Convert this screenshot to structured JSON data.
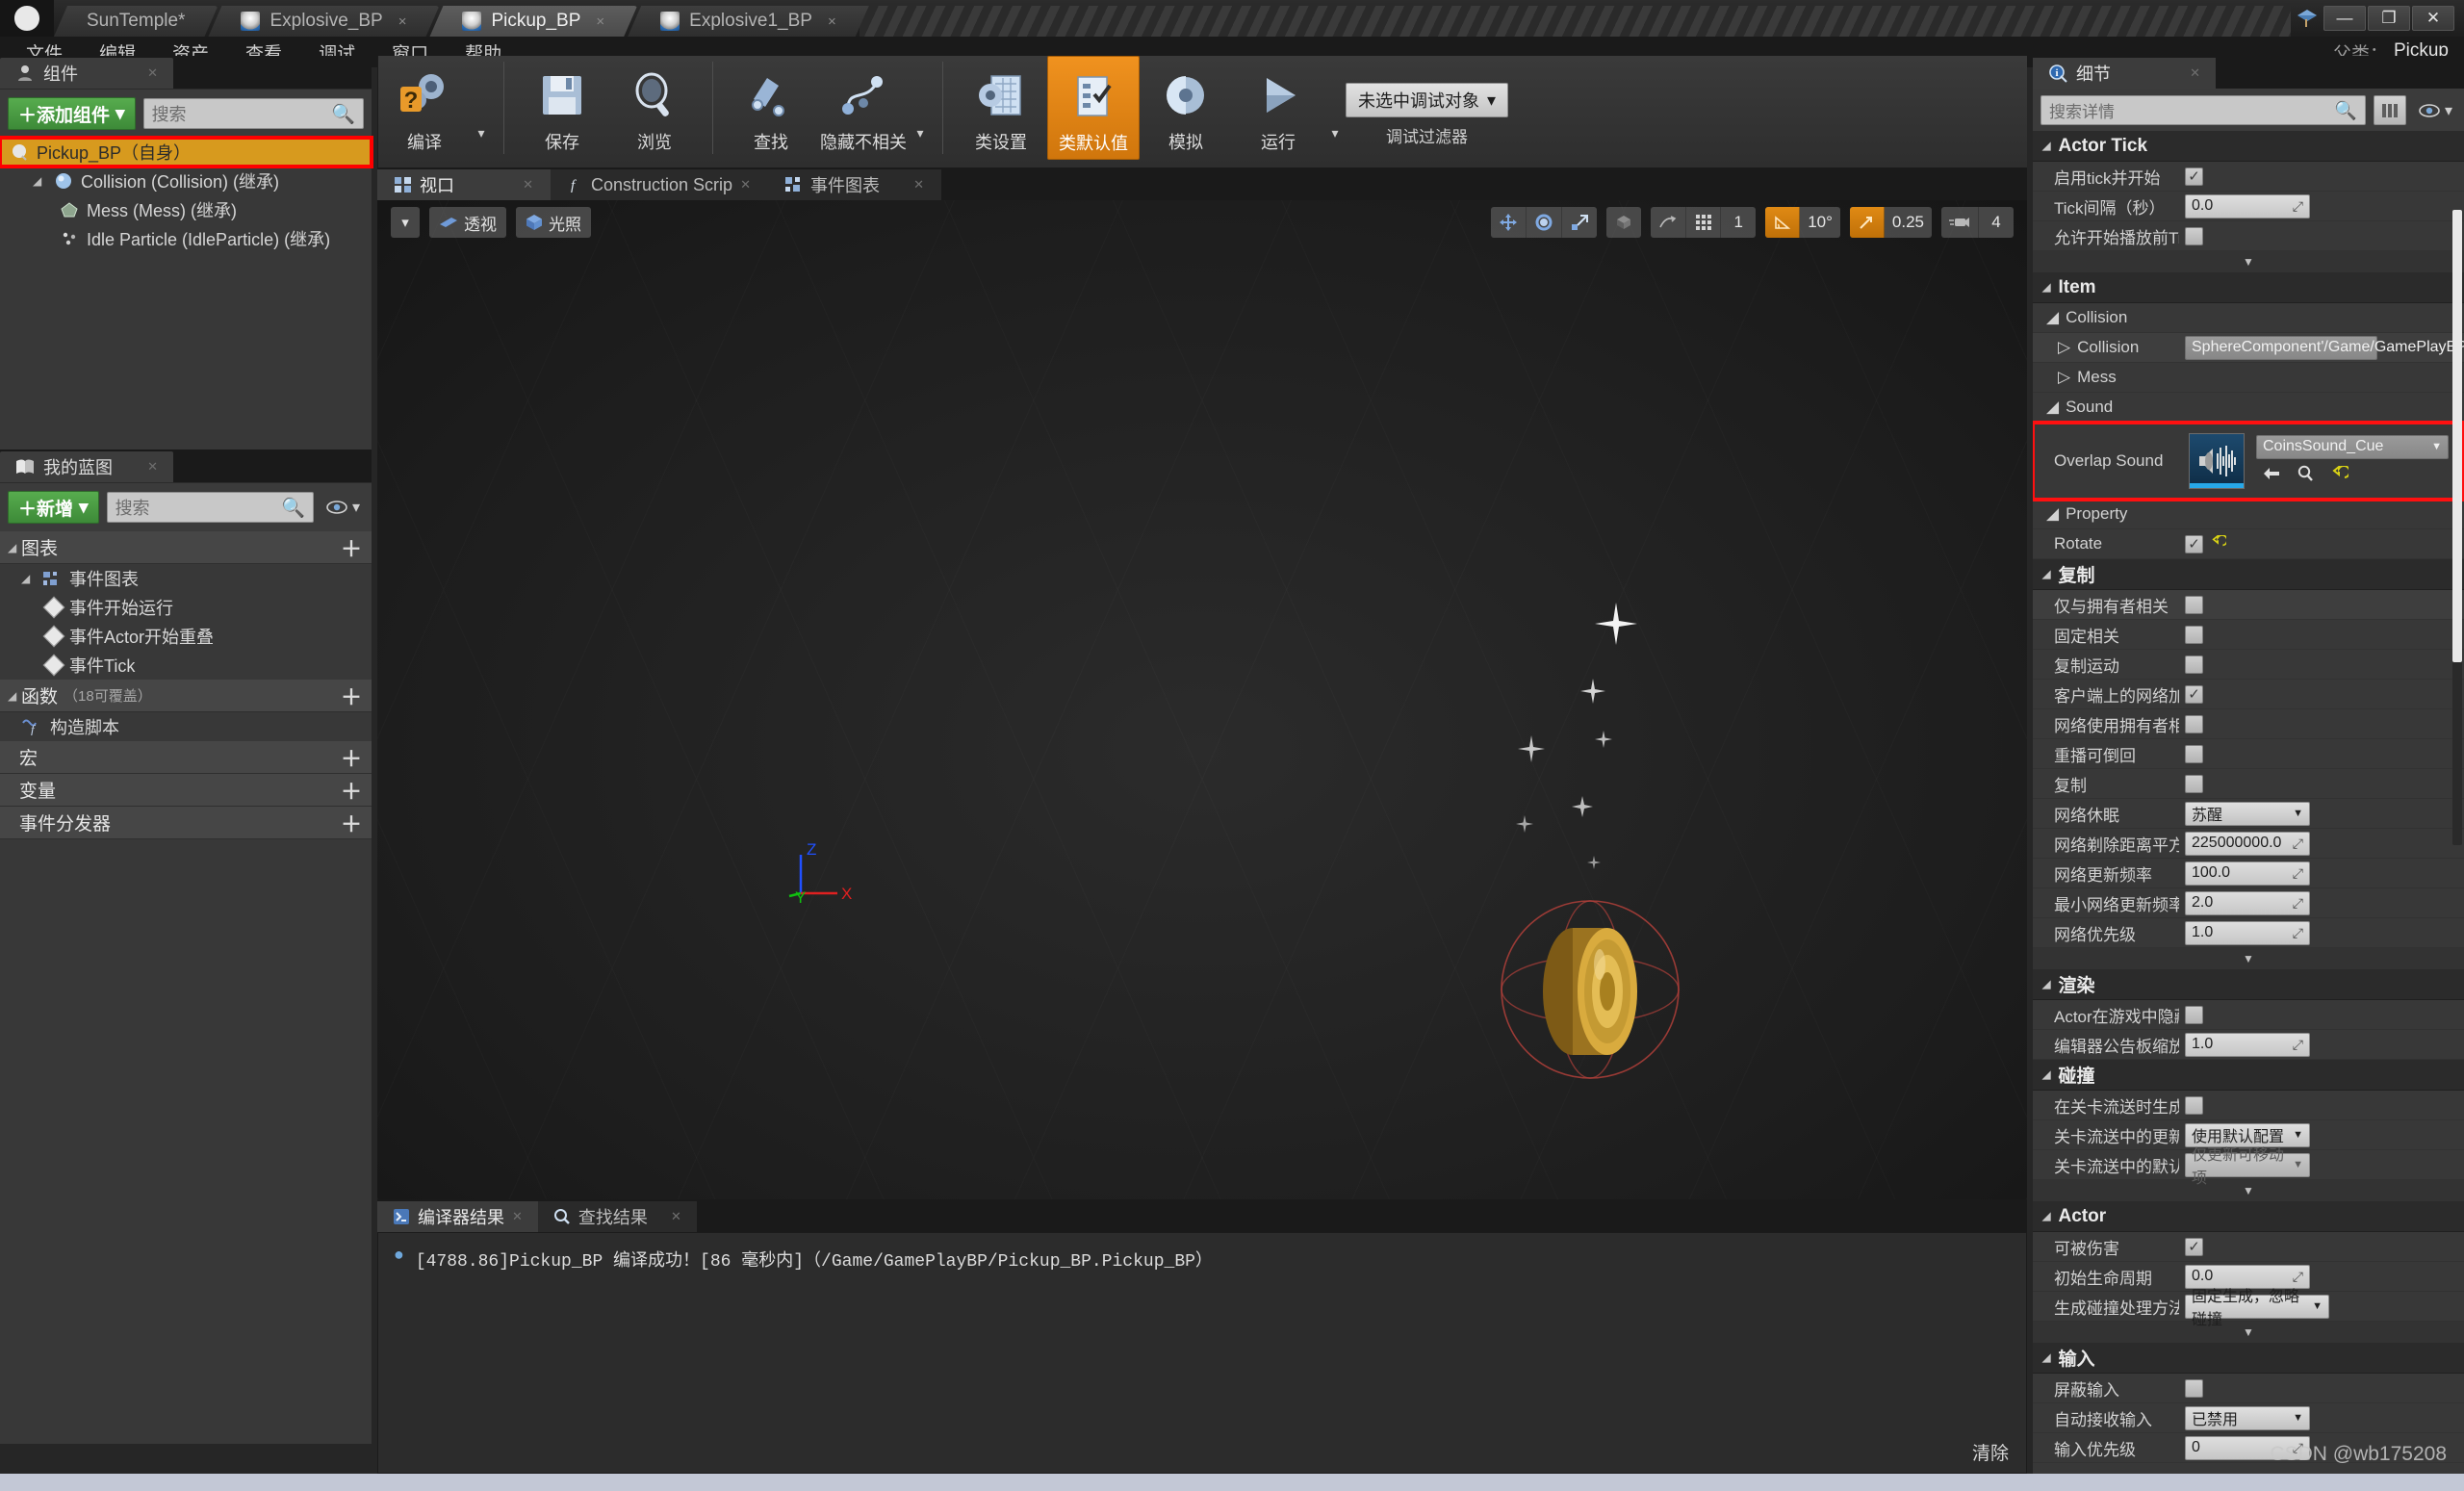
{
  "titlebar": {
    "logo": "U",
    "tabs": [
      {
        "label": "SunTemple*",
        "kind": "level",
        "state": "dim"
      },
      {
        "label": "Explosive_BP",
        "kind": "bp",
        "state": "dim"
      },
      {
        "label": "Pickup_BP",
        "kind": "bp",
        "state": "active"
      },
      {
        "label": "Explosive1_BP",
        "kind": "bp",
        "state": "dim"
      }
    ],
    "close_glyph": "×",
    "window_buttons": [
      {
        "name": "minimize",
        "glyph": "—"
      },
      {
        "name": "maximize",
        "glyph": "❐"
      },
      {
        "name": "close",
        "glyph": "✕"
      }
    ]
  },
  "menubar": {
    "items": [
      "文件",
      "编辑",
      "资产",
      "查看",
      "调试",
      "窗口",
      "帮助"
    ],
    "parent_class_label": "父类：",
    "parent_class_value": "Pickup"
  },
  "components_panel": {
    "tab_title": "组件",
    "add_button": "＋添加组件",
    "add_caret": "▾",
    "search_placeholder": "搜索",
    "items": [
      {
        "label": "Pickup_BP（自身）",
        "indent": 0,
        "selected": true,
        "icon": "blueprint-icon",
        "expander": ""
      },
      {
        "label": "Collision (Collision) (继承)",
        "indent": 1,
        "selected": false,
        "icon": "sphere-collision-icon",
        "expander": "◢"
      },
      {
        "label": "Mess (Mess) (继承)",
        "indent": 2,
        "selected": false,
        "icon": "static-mesh-icon",
        "expander": ""
      },
      {
        "label": "Idle Particle (IdleParticle) (继承)",
        "indent": 2,
        "selected": false,
        "icon": "particle-icon",
        "expander": ""
      }
    ]
  },
  "myblueprint_panel": {
    "tab_title": "我的蓝图",
    "add_button": "＋新增",
    "add_caret": "▾",
    "search_placeholder": "搜索",
    "sections": [
      {
        "title": "图表",
        "suffix": "",
        "plus": "＋",
        "children": [
          {
            "label": "事件图表",
            "icon": "graph-icon",
            "indent": 1,
            "expander": "◢"
          },
          {
            "label": "事件开始运行",
            "icon": "event-node-icon",
            "indent": 2,
            "expander": ""
          },
          {
            "label": "事件Actor开始重叠",
            "icon": "event-node-icon",
            "indent": 2,
            "expander": ""
          },
          {
            "label": "事件Tick",
            "icon": "event-node-icon",
            "indent": 2,
            "expander": ""
          }
        ]
      },
      {
        "title": "函数",
        "suffix": "（18可覆盖）",
        "plus": "＋",
        "children": [
          {
            "label": "构造脚本",
            "icon": "function-icon",
            "indent": 1,
            "expander": ""
          }
        ]
      },
      {
        "title": "宏",
        "suffix": "",
        "plus": "＋",
        "children": []
      },
      {
        "title": "变量",
        "suffix": "",
        "plus": "＋",
        "children": []
      },
      {
        "title": "事件分发器",
        "suffix": "",
        "plus": "＋",
        "children": []
      }
    ]
  },
  "toolbar": {
    "buttons": [
      {
        "label": "编译",
        "icon": "compile-icon",
        "active": false,
        "caret": true
      },
      {
        "label": "保存",
        "icon": "save-icon",
        "active": false,
        "caret": false
      },
      {
        "label": "浏览",
        "icon": "browse-icon",
        "active": false,
        "caret": false
      },
      {
        "label": "查找",
        "icon": "find-icon",
        "active": false,
        "caret": false
      },
      {
        "label": "隐藏不相关",
        "icon": "hide-unrelated-icon",
        "active": false,
        "caret": true
      },
      {
        "label": "类设置",
        "icon": "class-settings-icon",
        "active": false,
        "caret": false
      },
      {
        "label": "类默认值",
        "icon": "class-defaults-icon",
        "active": true,
        "caret": false
      },
      {
        "label": "模拟",
        "icon": "simulate-icon",
        "active": false,
        "caret": false
      },
      {
        "label": "运行",
        "icon": "play-icon",
        "active": false,
        "caret": true
      }
    ],
    "debug_object": "未选中调试对象",
    "debug_caret": "▾",
    "debug_filter_label": "调试过滤器"
  },
  "center_tabs": [
    {
      "label": "视口",
      "icon": "viewport-icon",
      "active": true
    },
    {
      "label": "Construction Scrip",
      "icon": "function-icon",
      "active": false
    },
    {
      "label": "事件图表",
      "icon": "graph-icon",
      "active": false
    }
  ],
  "viewport": {
    "caret": "▾",
    "view_mode": "透视",
    "lighting_mode": "光照",
    "transform_tools": [
      "move-gizmo-icon",
      "rotate-gizmo-icon",
      "scale-gizmo-icon"
    ],
    "world_space_icon": "world-space-icon",
    "surface_snap_icon": "surface-snap-icon",
    "grid_snap_icon": "grid-snap-icon",
    "grid_snap_value": "1",
    "rotation_snap_icon": "rotation-snap-icon",
    "rotation_snap_value": "10°",
    "scale_snap_icon": "scale-snap-icon",
    "scale_snap_value": "0.25",
    "camera_speed_icon": "camera-speed-icon",
    "camera_speed_value": "4",
    "axis_labels": {
      "x": "X",
      "y": "Y",
      "z": "Z"
    }
  },
  "results_panel": {
    "tabs": [
      {
        "label": "编译器结果",
        "icon": "compiler-results-icon",
        "active": true
      },
      {
        "label": "查找结果",
        "icon": "find-results-icon",
        "active": false
      }
    ],
    "lines": [
      "[4788.86]Pickup_BP 编译成功！[86 毫秒内]（/Game/GamePlayBP/Pickup_BP.Pickup_BP）"
    ],
    "clear_label": "清除"
  },
  "details_panel": {
    "tab_title": "细节",
    "search_placeholder": "搜索详情",
    "categories": [
      {
        "name": "Actor Tick",
        "rows": [
          {
            "label": "启用tick并开始",
            "type": "checkbox",
            "value": true
          },
          {
            "label": "Tick间隔（秒）",
            "type": "number",
            "value": "0.0"
          },
          {
            "label": "允许开始播放前Tick",
            "type": "checkbox",
            "value": false
          }
        ],
        "collapser": true
      },
      {
        "name": "Item",
        "rows": [
          {
            "label": "Collision",
            "type": "subheader",
            "expander": "◢"
          },
          {
            "label": "Collision",
            "type": "asset-readonly",
            "value": "SphereComponent'/Game/GamePlayBP,",
            "expander": "▷"
          },
          {
            "label": "Mess",
            "type": "subheader-collapsed",
            "expander": "▷"
          },
          {
            "label": "Sound",
            "type": "subheader",
            "expander": "◢"
          },
          {
            "label": "Overlap Sound",
            "type": "asset-picker",
            "value": "CoinsSound_Cue",
            "thumb": "sound-cue-icon",
            "highlight": true,
            "actions": [
              "back-arrow-icon",
              "browse-magnifier-icon",
              "revert-icon"
            ]
          },
          {
            "label": "Property",
            "type": "subheader",
            "expander": "◢"
          },
          {
            "label": "Rotate",
            "type": "checkbox",
            "value": true,
            "revert": true
          }
        ],
        "collapser": false
      },
      {
        "name": "复制",
        "rows": [
          {
            "label": "仅与拥有者相关",
            "type": "checkbox",
            "value": false
          },
          {
            "label": "固定相关",
            "type": "checkbox",
            "value": false
          },
          {
            "label": "复制运动",
            "type": "checkbox",
            "value": false
          },
          {
            "label": "客户端上的网络加载",
            "type": "checkbox",
            "value": true
          },
          {
            "label": "网络使用拥有者相关性",
            "type": "checkbox",
            "value": false
          },
          {
            "label": "重播可倒回",
            "type": "checkbox",
            "value": false
          },
          {
            "label": "复制",
            "type": "checkbox",
            "value": false
          },
          {
            "label": "网络休眠",
            "type": "dropdown",
            "value": "苏醒"
          },
          {
            "label": "网络剃除距离平方",
            "type": "number",
            "value": "225000000.0"
          },
          {
            "label": "网络更新频率",
            "type": "number",
            "value": "100.0"
          },
          {
            "label": "最小网络更新频率",
            "type": "number",
            "value": "2.0"
          },
          {
            "label": "网络优先级",
            "type": "number",
            "value": "1.0"
          }
        ],
        "collapser": true
      },
      {
        "name": "渲染",
        "rows": [
          {
            "label": "Actor在游戏中隐藏",
            "type": "checkbox",
            "value": false
          },
          {
            "label": "编辑器公告板缩放",
            "type": "number",
            "value": "1.0"
          }
        ],
        "collapser": false
      },
      {
        "name": "碰撞",
        "rows": [
          {
            "label": "在关卡流送时生成重叠",
            "type": "checkbox",
            "value": false
          },
          {
            "label": "关卡流送中的更新重叠",
            "type": "dropdown",
            "value": "使用默认配置"
          },
          {
            "label": "关卡流送中的默认更新",
            "type": "dropdown-dim",
            "value": "仅更新可移动项"
          }
        ],
        "collapser": true
      },
      {
        "name": "Actor",
        "rows": [
          {
            "label": "可被伤害",
            "type": "checkbox",
            "value": true
          },
          {
            "label": "初始生命周期",
            "type": "number",
            "value": "0.0"
          },
          {
            "label": "生成碰撞处理方法",
            "type": "dropdown-wide",
            "value": "固定生成，忽略碰撞"
          }
        ],
        "collapser": true
      },
      {
        "name": "输入",
        "rows": [
          {
            "label": "屏蔽输入",
            "type": "checkbox",
            "value": false
          },
          {
            "label": "自动接收输入",
            "type": "dropdown",
            "value": "已禁用"
          },
          {
            "label": "输入优先级",
            "type": "number",
            "value": "0"
          }
        ],
        "collapser": false
      }
    ]
  },
  "watermark": "CSDN @wb175208",
  "colors": {
    "accent_orange": "#e08a14",
    "selection_orange": "#d79a1e",
    "highlight_red": "#ff1010",
    "green_button": "#57ac4e",
    "panel_bg": "#383838"
  }
}
